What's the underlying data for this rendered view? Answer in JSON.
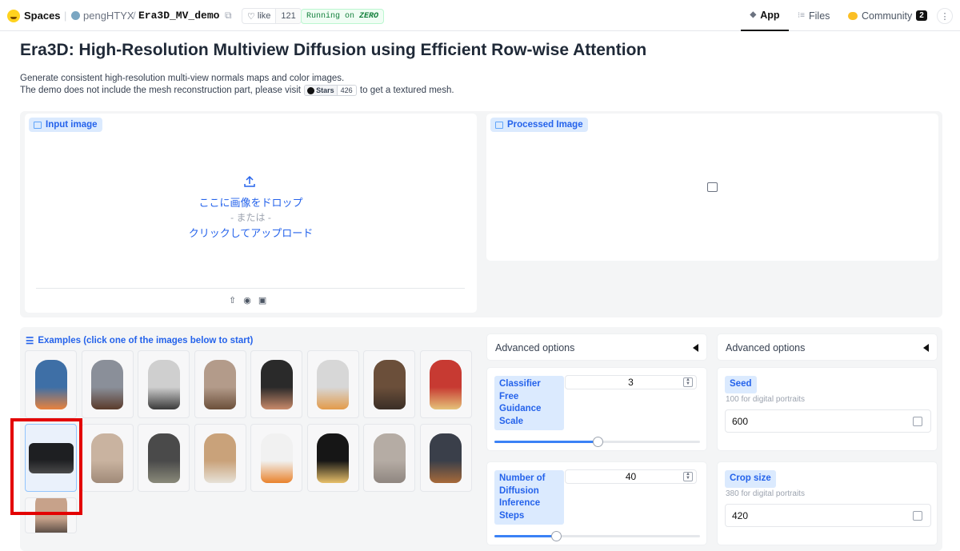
{
  "topbar": {
    "spaces": "Spaces",
    "owner": "pengHTYX",
    "repo": "Era3D_MV_demo",
    "like": "like",
    "like_count": "121",
    "running": "Running on",
    "running_hw": "ZERO",
    "nav": {
      "app": "App",
      "files": "Files",
      "community": "Community",
      "community_count": "2"
    }
  },
  "title": "Era3D: High-Resolution Multiview Diffusion using Efficient Row-wise Attention",
  "desc": {
    "line1": "Generate consistent high-resolution multi-view normals maps and color images.",
    "line2_a": "The demo does not include the mesh reconstruction part, please visit",
    "stars": "Stars",
    "stars_count": "426",
    "line2_b": "to get a textured mesh."
  },
  "input_panel": {
    "label": "Input image",
    "drop": "ここに画像をドロップ",
    "or": "- または -",
    "click": "クリックしてアップロード"
  },
  "processed_panel": {
    "label": "Processed Image"
  },
  "examples": {
    "label": "Examples (click one of the images below to start)",
    "items": [
      {
        "color": "#3e6fa6",
        "accent": "#e9823c"
      },
      {
        "color": "#8a8f99",
        "accent": "#5a3a2a"
      },
      {
        "color": "#cfcfcf",
        "accent": "#3a3a3a"
      },
      {
        "color": "#b39b8a",
        "accent": "#6b4f3a"
      },
      {
        "color": "#2a2a2a",
        "accent": "#c98a6a"
      },
      {
        "color": "#d7d7d7",
        "accent": "#e39b4a"
      },
      {
        "color": "#6b4f3a",
        "accent": "#3a2e26"
      },
      {
        "color": "#c73a32",
        "accent": "#e5c27a"
      },
      {
        "color": "#1e1f22",
        "accent": "#4a4a4a"
      },
      {
        "color": "#c9b3a0",
        "accent": "#a08a78"
      },
      {
        "color": "#4a4a4a",
        "accent": "#8a8a7a"
      },
      {
        "color": "#c9a27a",
        "accent": "#e7e2d8"
      },
      {
        "color": "#f1f1f1",
        "accent": "#e9822c"
      },
      {
        "color": "#161616",
        "accent": "#e8c06a"
      },
      {
        "color": "#b5aca4",
        "accent": "#8f8680"
      },
      {
        "color": "#3a3f4a",
        "accent": "#a86a3a"
      },
      {
        "color": "#c7a28a",
        "accent": "#222222"
      }
    ]
  },
  "advanced_left": {
    "header": "Advanced options",
    "cfg": {
      "label": "Classifier Free Guidance Scale",
      "value": "3",
      "fraction": 0.5
    },
    "steps": {
      "label": "Number of Diffusion Inference Steps",
      "value": "40",
      "fraction": 0.3
    }
  },
  "advanced_right": {
    "header": "Advanced options",
    "seed": {
      "label": "Seed",
      "hint": "100 for digital portraits",
      "value": "600"
    },
    "crop": {
      "label": "Crop size",
      "hint": "380 for digital portraits",
      "value": "420"
    }
  }
}
